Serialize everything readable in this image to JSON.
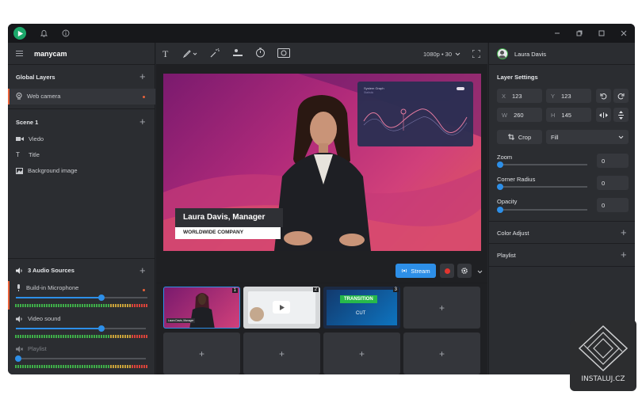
{
  "app": {
    "brand": "manycam"
  },
  "titlebar": {
    "window_buttons": [
      "minimize-icon",
      "restore-icon",
      "maximize-icon",
      "close-icon"
    ]
  },
  "toolbar": {
    "resolution": "1080p • 30"
  },
  "left": {
    "global_layers": {
      "title": "Global Layers",
      "items": [
        "Web camera"
      ]
    },
    "scene": {
      "title": "Scene 1",
      "items": [
        "Viedo",
        "Title",
        "Background image"
      ]
    },
    "audio": {
      "title": "3 Audio Sources",
      "sources": [
        {
          "label": "Build-in Microphone",
          "level": 0.65
        },
        {
          "label": "Video sound",
          "level": 0.65
        },
        {
          "label": "Playlist",
          "level": 0.02
        }
      ]
    }
  },
  "preview": {
    "lower_third": {
      "name": "Laura Davis, Manager",
      "company": "WORLDWIDE COMPANY"
    },
    "overlay_chart": {
      "title": "System Graph",
      "subtitle": "Statistic"
    }
  },
  "controls": {
    "stream_label": "Stream"
  },
  "scenes": {
    "thumbs": [
      {
        "num": "1",
        "caption": "Laura Davis, Manager"
      },
      {
        "num": "2"
      },
      {
        "num": "3",
        "transition": "TRANSITION",
        "cut": "CUT"
      }
    ]
  },
  "right": {
    "user": "Laura Davis",
    "layer_settings": {
      "title": "Layer Settings",
      "x_label": "X",
      "x": "123",
      "y_label": "Y",
      "y": "123",
      "w_label": "W",
      "w": "260",
      "h_label": "H",
      "h": "145",
      "crop_label": "Crop",
      "fill_option": "Fill",
      "zoom_label": "Zoom",
      "zoom": "0",
      "radius_label": "Corner Radius",
      "radius": "0",
      "opacity_label": "Opacity",
      "opacity": "0"
    },
    "color_adjust": "Color Adjust",
    "playlist": "Playlist"
  },
  "watermark": {
    "label": "INSTALUJ.CZ"
  },
  "colors": {
    "accent": "#2d8fe8",
    "orange": "#e8623a",
    "stream": "#2d8fe8"
  }
}
